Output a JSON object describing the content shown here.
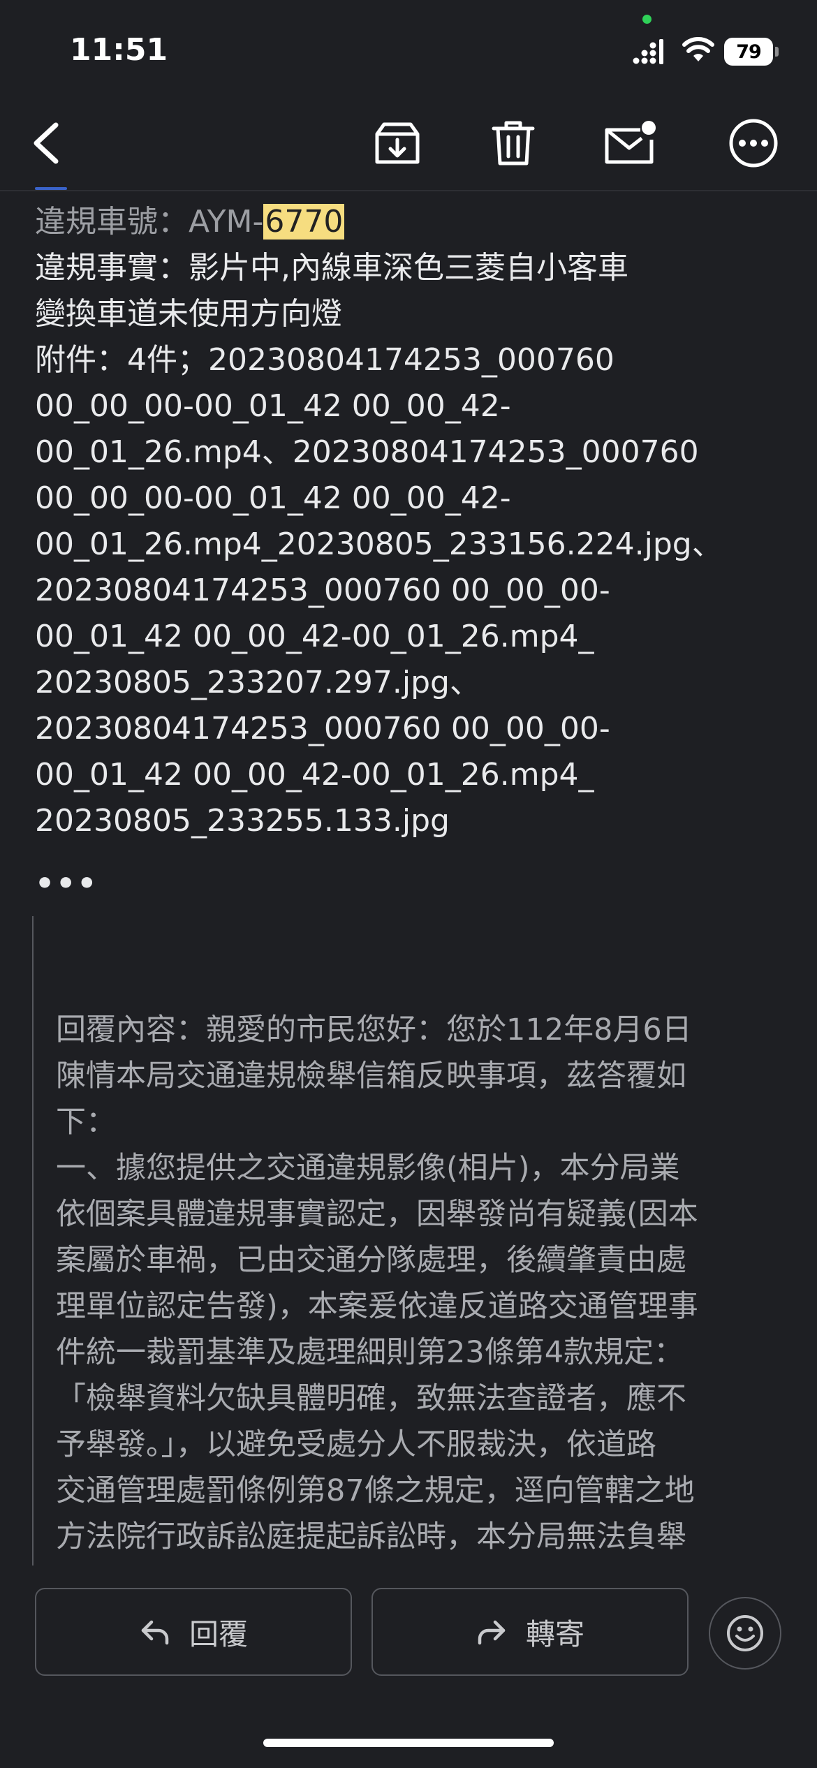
{
  "status": {
    "time": "11:51",
    "battery": "79"
  },
  "toolbar": {
    "back": "back-icon",
    "archive": "archive-icon",
    "delete": "trash-icon",
    "unread": "mail-unread-icon",
    "more": "more-icon"
  },
  "message": {
    "plate_label": "違規車號：AYM-",
    "plate_highlight": "6770",
    "lines": [
      "違規事實：影片中,內線車深色三菱自小客車",
      "變換車道未使用方向燈",
      "附件：4件；20230804174253_000760",
      "00_00_00-00_01_42 00_00_42-",
      "00_01_26.mp4、20230804174253_000760",
      "00_00_00-00_01_42 00_00_42-",
      "00_01_26.mp4_20230805_233156.224.jpg、",
      "20230804174253_000760 00_00_00-",
      "00_01_42 00_00_42-00_01_26.mp4_",
      "20230805_233207.297.jpg、",
      "20230804174253_000760 00_00_00-",
      "00_01_42 00_00_42-00_01_26.mp4_",
      "20230805_233255.133.jpg"
    ],
    "more_indicator": "•••"
  },
  "quoted": {
    "lines": [
      "回覆內容：親愛的市民您好：您於112年8月6日",
      "陳情本局交通違規檢舉信箱反映事項，茲答覆如",
      "下：",
      "一、據您提供之交通違規影像(相片)，本分局業",
      "依個案具體違規事實認定，因舉發尚有疑義(因本",
      "案屬於車禍，已由交通分隊處理，後續肇責由處",
      "理單位認定告發)，本案爰依違反道路交通管理事",
      "件統一裁罰基準及處理細則第23條第4款規定：",
      "「檢舉資料欠缺具體明確，致無法查證者，應不",
      "予舉發。」，以避免受處分人不服裁決，依道路",
      "交通管理處罰條例第87條之規定，逕向管轄之地",
      "方法院行政訴訟庭提起訴訟時，本分局無法負舉"
    ]
  },
  "actions": {
    "reply_label": "回覆",
    "forward_label": "轉寄",
    "emoji": "emoji-icon"
  },
  "colors": {
    "background": "#1e1f23",
    "text": "#e9eaec",
    "quote_text": "#a9abb0",
    "highlight": "#f6dd80"
  }
}
